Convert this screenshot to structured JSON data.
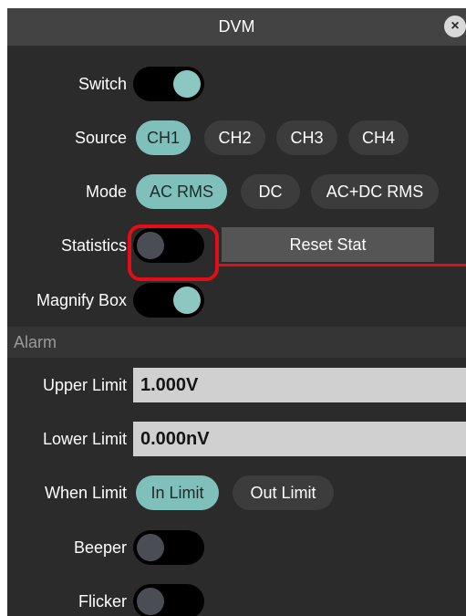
{
  "dialog": {
    "title": "DVM",
    "close_glyph": "×"
  },
  "switch": {
    "label": "Switch",
    "state": "on"
  },
  "source": {
    "label": "Source",
    "options": [
      "CH1",
      "CH2",
      "CH3",
      "CH4"
    ],
    "selected": "CH1"
  },
  "mode": {
    "label": "Mode",
    "options": [
      "AC RMS",
      "DC",
      "AC+DC RMS"
    ],
    "selected": "AC RMS"
  },
  "statistics": {
    "label": "Statistics",
    "state": "off",
    "reset_label": "Reset Stat"
  },
  "magnify_box": {
    "label": "Magnify Box",
    "state": "on"
  },
  "alarm": {
    "section_label": "Alarm",
    "upper_limit": {
      "label": "Upper Limit",
      "value": "1.000V"
    },
    "lower_limit": {
      "label": "Lower Limit",
      "value": "0.000nV"
    },
    "when_limit": {
      "label": "When Limit",
      "options": [
        "In Limit",
        "Out Limit"
      ],
      "selected": "In Limit"
    },
    "beeper": {
      "label": "Beeper",
      "state": "off"
    },
    "flicker": {
      "label": "Flicker",
      "state": "off"
    }
  },
  "colors": {
    "panel_bg": "#2b2b2b",
    "accent": "#7fc0bb",
    "annotation": "#e30d17"
  }
}
